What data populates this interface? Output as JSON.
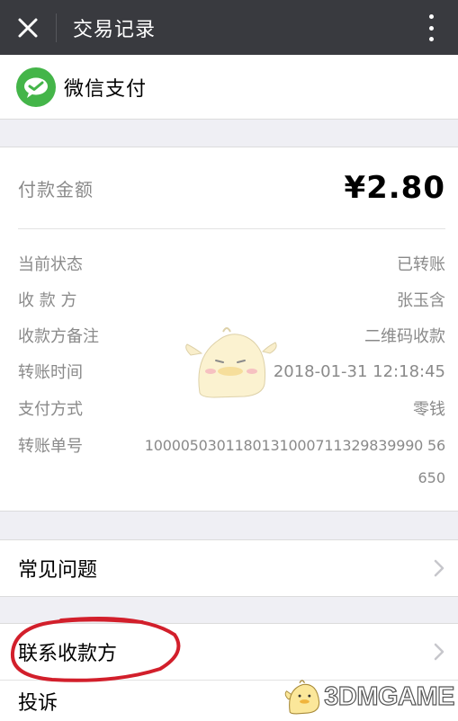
{
  "topbar": {
    "title": "交易记录",
    "close_icon": "close-icon",
    "more_icon": "more-vertical-icon"
  },
  "brand": {
    "name": "微信支付",
    "logo_icon": "wechat-pay-logo",
    "color": "#44b549"
  },
  "payment": {
    "amount_label": "付款金额",
    "amount_value": "¥2.80",
    "details": [
      {
        "label": "当前状态",
        "value": "已转账"
      },
      {
        "label": "收 款 方",
        "value": "张玉含"
      },
      {
        "label": "收款方备注",
        "value": "二维码收款"
      },
      {
        "label": "转账时间",
        "value": "2018-01-31 12:18:45"
      },
      {
        "label": "支付方式",
        "value": "零钱"
      },
      {
        "label": "转账单号",
        "value": "1000050301180131000711329839990 56"
      }
    ],
    "transfer_no_tail": "650"
  },
  "menu": {
    "faq": "常见问题",
    "contact": "联系收款方",
    "complain": "投诉"
  },
  "annotation": {
    "color": "#d21f2b"
  },
  "watermark": {
    "text": "3DMGAME"
  }
}
